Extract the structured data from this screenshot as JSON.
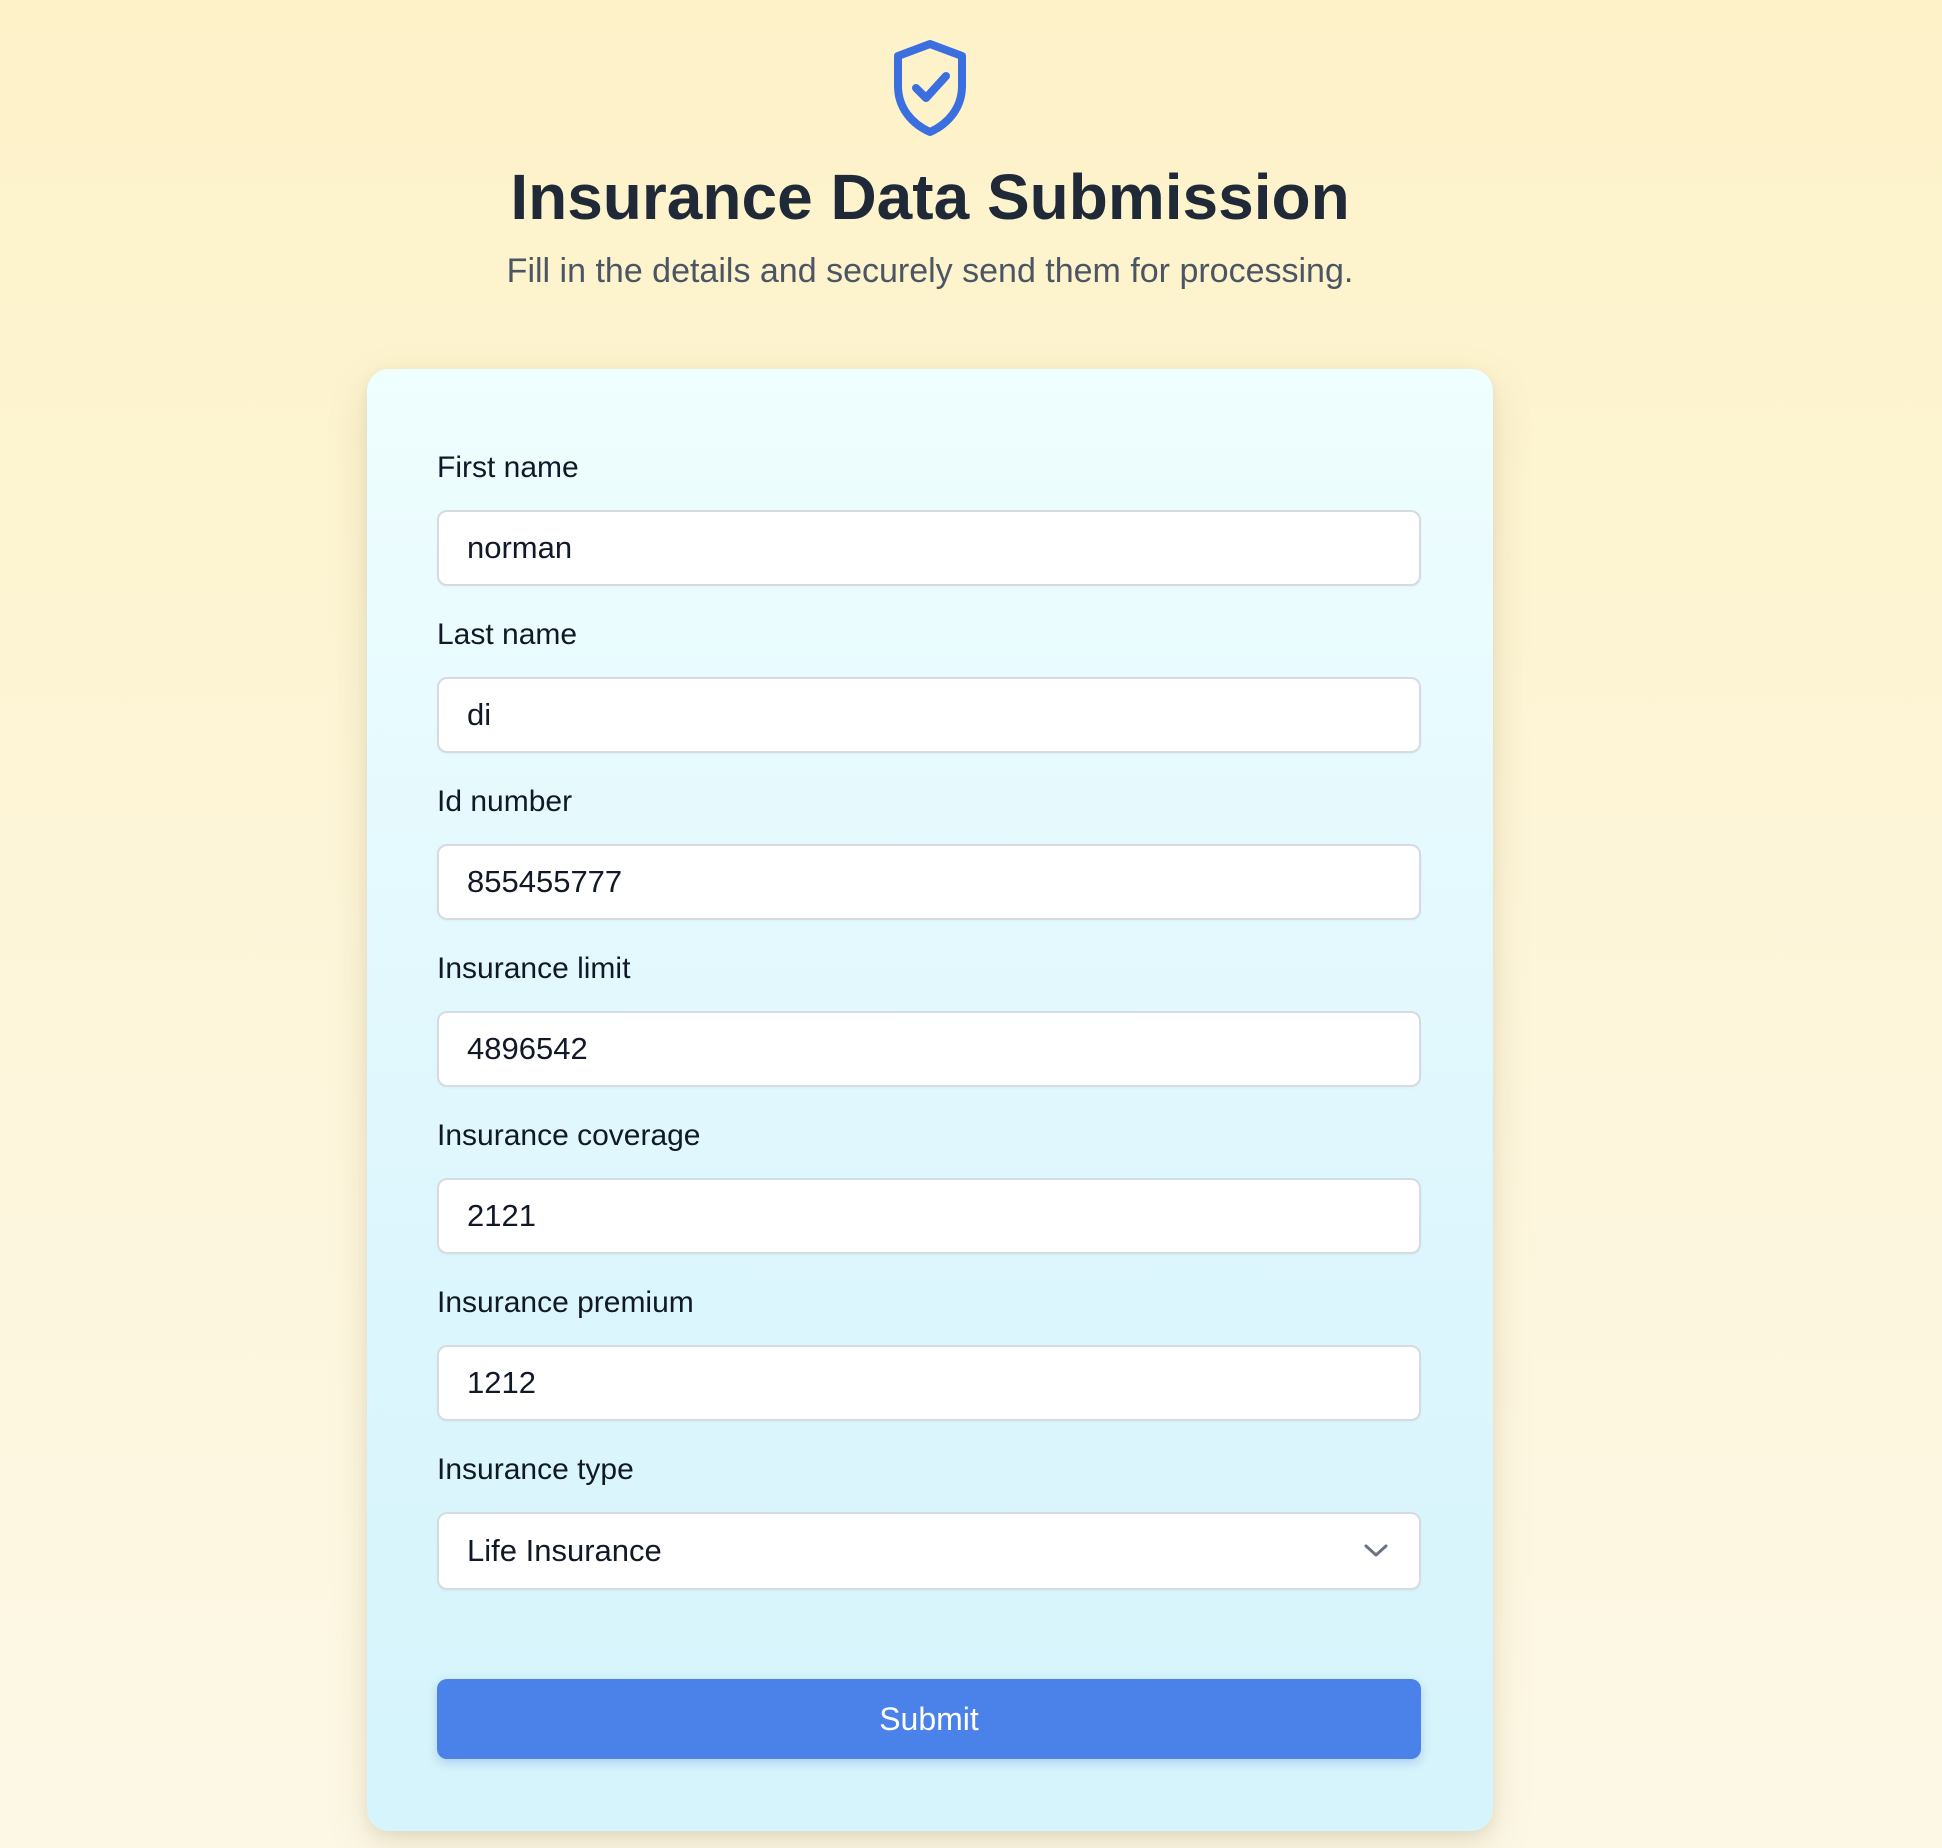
{
  "header": {
    "icon": "shield-check-icon",
    "title": "Insurance Data Submission",
    "subtitle": "Fill in the details and securely send them for processing."
  },
  "form": {
    "fields": [
      {
        "label": "First name",
        "value": "norman"
      },
      {
        "label": "Last name",
        "value": "di"
      },
      {
        "label": "Id number",
        "value": "855455777"
      },
      {
        "label": "Insurance limit",
        "value": "4896542"
      },
      {
        "label": "Insurance coverage",
        "value": "2121"
      },
      {
        "label": "Insurance premium",
        "value": "1212"
      }
    ],
    "insurance_type": {
      "label": "Insurance type",
      "value": "Life Insurance",
      "icon": "chevron-down-icon"
    },
    "submit_label": "Submit"
  },
  "colors": {
    "accent": "#4b82ea",
    "shield": "#3b6fe0",
    "title": "#1f2937",
    "subtitle": "#4b5563"
  }
}
